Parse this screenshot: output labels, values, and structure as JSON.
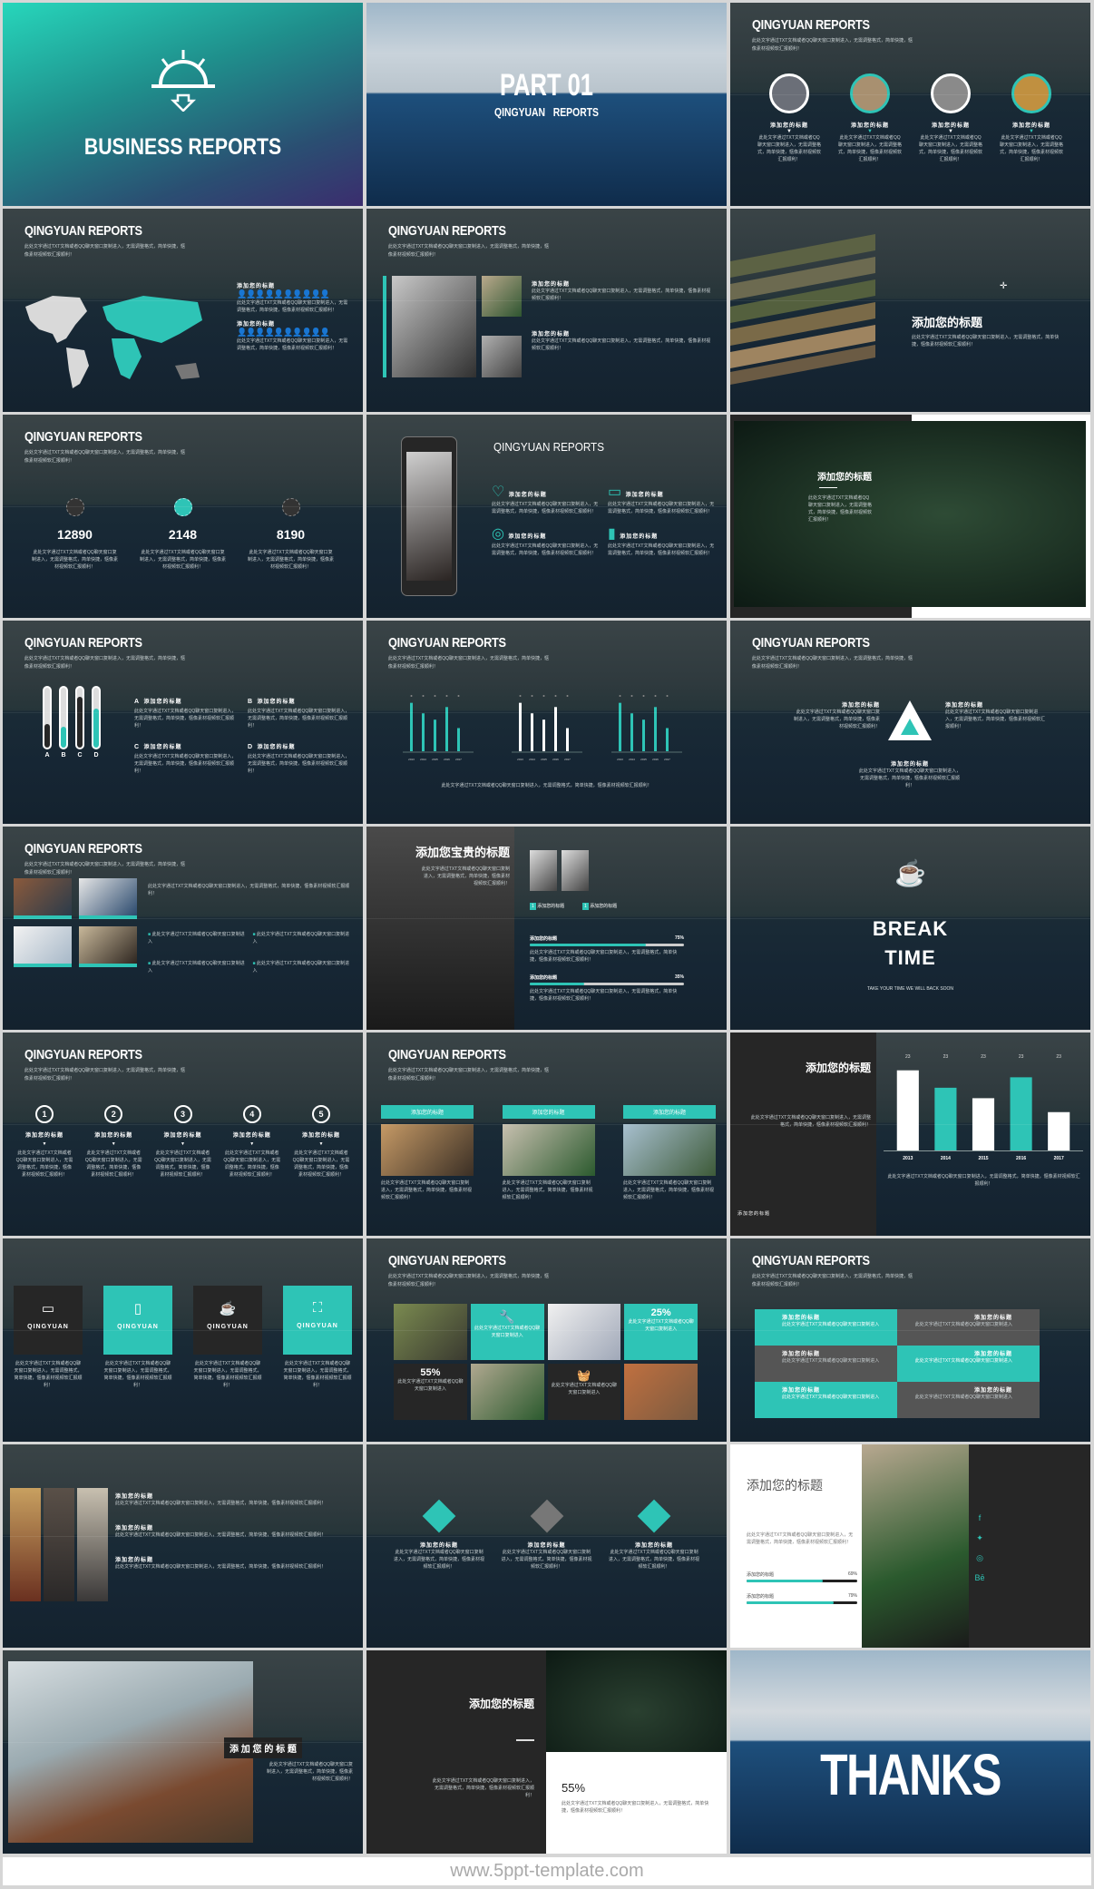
{
  "brand": {
    "accent": "#2ec4b6",
    "dark": "#262626",
    "gray": "#555555"
  },
  "common": {
    "report_title": "QINGYUAN REPORTS",
    "subtitle": "此处文字通过TXT文档或者QQ聊天窗口复制进入，无需调整格式，简单快捷，惬像素材视频软汇报顺利！",
    "heading": "添加您的标题",
    "body": "此处文字通过TXT文档或者QQ聊天窗口复制进入，无需调整格式，简单快捷，惬像素材视频软汇报顺利！",
    "short_body": "此处文字通过TXT文档或者QQ聊天窗口复制进入"
  },
  "slides": {
    "s1": {
      "title": "BUSINESS REPORTS",
      "icon": "sunrise-icon"
    },
    "s2": {
      "title": "PART 01",
      "subtitle": "QINGYUAN   REPORTS"
    },
    "s3": {
      "profiles": [
        "添加您的标题",
        "添加您的标题",
        "添加您的标题",
        "添加您的标题"
      ]
    },
    "s4": {
      "items": [
        "添加您的标题",
        "添加您的标题"
      ]
    },
    "s5": {
      "items": [
        "添加您的标题",
        "添加您的标题"
      ]
    },
    "s6": {
      "heading": "添加您的标题"
    },
    "s7": {
      "stats": [
        "12890",
        "2148",
        "8190"
      ]
    },
    "s8": {
      "title": "QINGYUAN REPORTS",
      "items": [
        "添加您的标题",
        "添加您的标题",
        "添加您的标题",
        "添加您的标题"
      ]
    },
    "s9": {
      "heading": "添加您的标题"
    },
    "s10": {
      "gauges": [
        {
          "label": "A",
          "value": 0.4
        },
        {
          "label": "B",
          "value": 0.35
        },
        {
          "label": "C",
          "value": 0.85
        },
        {
          "label": "D",
          "value": 0.65
        }
      ],
      "items": [
        {
          "letter": "A",
          "heading": "添加您的标题"
        },
        {
          "letter": "B",
          "heading": "添加您的标题"
        },
        {
          "letter": "C",
          "heading": "添加您的标题"
        },
        {
          "letter": "D",
          "heading": "添加您的标题"
        }
      ]
    },
    "s11": {
      "years": [
        "2013",
        "2014",
        "2015",
        "2016",
        "2017"
      ]
    },
    "s12": {
      "items": [
        "添加您的标题",
        "添加您的标题",
        "添加您的标题"
      ]
    },
    "s14": {
      "heading": "添加您宝贵的标题",
      "tags": [
        "1",
        "1"
      ],
      "tag_labels": [
        "添加您的标题",
        "添加您的标题"
      ],
      "progress": [
        {
          "label": "添加您的标题",
          "value": 0.75,
          "text": "75%"
        },
        {
          "label": "添加您的标题",
          "value": 0.35,
          "text": "35%"
        }
      ]
    },
    "s15": {
      "line1": "BREAK",
      "line2": "TIME",
      "caption": "TAKE YOUR TIME WE WILL BACK SOON"
    },
    "s16": {
      "steps": [
        "1",
        "2",
        "3",
        "4",
        "5"
      ],
      "heading": "添加您的标题"
    },
    "s17": {
      "banners": [
        "添加您的标题",
        "添加您的标题",
        "添加您的标题"
      ]
    },
    "s18": {
      "heading": "添加您的标题",
      "footer_label": "添加您的标题"
    },
    "s19": {
      "boxes": [
        "QINGYUAN",
        "QINGYUAN",
        "QINGYUAN",
        "QINGYUAN"
      ]
    },
    "s20": {
      "pct1": "25%",
      "pct2": "55%"
    },
    "s22": {
      "items": [
        "添加您的标题",
        "添加您的标题",
        "添加您的标题"
      ]
    },
    "s23": {
      "items": [
        "添加您的标题",
        "添加您的标题",
        "添加您的标题"
      ]
    },
    "s24": {
      "heading": "添加您的标题",
      "progress": [
        {
          "label": "添加您的标题",
          "value": 0.69,
          "text": "69%"
        },
        {
          "label": "添加您的标题",
          "value": 0.79,
          "text": "79%"
        }
      ]
    },
    "s25": {
      "heading": "添 加 您 的 标 题"
    },
    "s26": {
      "heading": "添加您的标题",
      "pct": "55%"
    },
    "s27": {
      "title": "THANKS"
    }
  },
  "chart_data": {
    "type": "bar",
    "title": "添加您的标题",
    "categories": [
      "2013",
      "2014",
      "2015",
      "2016",
      "2017"
    ],
    "values": [
      23,
      18,
      15,
      21,
      11
    ],
    "value_labels": [
      "23",
      "23",
      "23",
      "23",
      "23"
    ],
    "series_colors": [
      "#ffffff",
      "#2ec4b6",
      "#ffffff",
      "#2ec4b6",
      "#ffffff"
    ],
    "xlabel": "",
    "ylabel": "",
    "ylim": [
      0,
      25
    ],
    "grid": false
  },
  "footer": {
    "url": "www.5ppt-template.com"
  }
}
